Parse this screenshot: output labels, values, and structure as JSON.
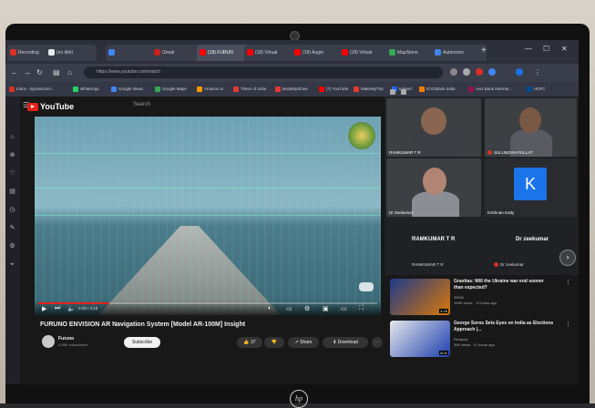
{
  "browser": {
    "tabs": [
      {
        "label": "Recording",
        "color": "#d93025"
      },
      {
        "label": "(no title)",
        "color": "#e8eaed"
      },
      {
        "label": "",
        "color": "#4285f4"
      },
      {
        "label": "Gmail",
        "color": "#c5221f"
      },
      {
        "label": "(18) FURUN",
        "color": "#ff0000"
      },
      {
        "label": "(18) Virtual",
        "color": "#ff0000"
      },
      {
        "label": "(18) Augm",
        "color": "#ff0000"
      },
      {
        "label": "(18) Virtual",
        "color": "#ff0000"
      },
      {
        "label": "MapStone",
        "color": "#34a853"
      },
      {
        "label": "Autonomo",
        "color": "#4285f4"
      }
    ],
    "url": "https://www.youtube.com/watch",
    "bookmarks": [
      {
        "label": "Inbox - dynamicsm...",
        "color": "#d93025"
      },
      {
        "label": "WhatsApp",
        "color": "#25d366"
      },
      {
        "label": "Google News",
        "color": "#4285f4"
      },
      {
        "label": "Google Maps",
        "color": "#34a853"
      },
      {
        "label": "Amazon.in",
        "color": "#ff9900"
      },
      {
        "label": "Times of India",
        "color": "#e53935"
      },
      {
        "label": "BookMyShow",
        "color": "#e53935"
      },
      {
        "label": "(7) YouTube",
        "color": "#ff0000"
      },
      {
        "label": "MakeMyTrip",
        "color": "#e53935"
      },
      {
        "label": "Indeed",
        "color": "#2164f3"
      },
      {
        "label": "ICICIBank India",
        "color": "#f57c00"
      },
      {
        "label": "Axis Bank Internet...",
        "color": "#97144d"
      },
      {
        "label": "HDFC",
        "color": "#004c8f"
      }
    ]
  },
  "youtube": {
    "logo": "YouTube",
    "search_placeholder": "Search",
    "video_time": "0:29 / 2:18",
    "progress_fraction": 0.21,
    "video_title": "FURUNO ENVISION AR Navigation System [Model AR-100M] Insight",
    "channel_name": "Furuno",
    "channel_subs": "4.99K subscribers",
    "subscribe": "Subscribe",
    "actions": [
      {
        "label": "👍 37"
      },
      {
        "label": "👎"
      },
      {
        "label": "↗ Share"
      },
      {
        "label": "⬇ Download"
      },
      {
        "label": "⋯"
      }
    ]
  },
  "meet": {
    "tiles": [
      {
        "name": "RAMKUMAR T R"
      },
      {
        "name": "SULUNDAN PULLAT"
      },
      {
        "name": "Dr Zeekumar"
      },
      {
        "name": "Krishnan Kutty"
      }
    ],
    "big_names": [
      "RAMKUMAR T R",
      "Dr zeekumar"
    ],
    "small_names": [
      "RAMKUMAR T R",
      "Dr zeekumar"
    ],
    "k_letter": "K"
  },
  "related": [
    {
      "title": "Gravitas: Will the Ukraine war end sooner than expected?",
      "channel": "WION",
      "meta": "154K views · 11 hours ago",
      "duration": "4:28"
    },
    {
      "title": "George Soros Sets Eyes on India as Elections Approach |...",
      "channel": "Firstpost",
      "meta": "39K views · 11 hours ago",
      "duration": "8:01"
    }
  ],
  "colors": {
    "accent": "#e62117",
    "meet_bg": "#202124",
    "k_avatar": "#1a73e8"
  }
}
